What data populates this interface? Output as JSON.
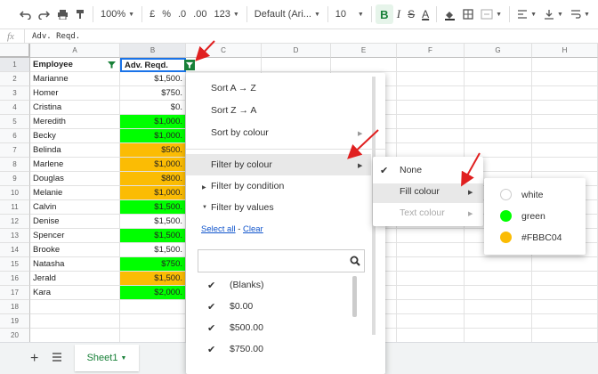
{
  "toolbar": {
    "zoom": "100%",
    "currency": "£",
    "percent": "%",
    "dec_decrease": ".0",
    "dec_increase": ".00",
    "number_format": "123",
    "font": "Default (Ari...",
    "font_size": "10",
    "bold": "B",
    "italic": "I",
    "strike": "S",
    "text_color": "A"
  },
  "formula_bar": {
    "fx": "fx",
    "value": "Adv. Reqd."
  },
  "columns": [
    "A",
    "B",
    "C",
    "D",
    "E",
    "F",
    "G",
    "H"
  ],
  "rows": [
    "1",
    "2",
    "3",
    "4",
    "5",
    "6",
    "7",
    "8",
    "9",
    "10",
    "11",
    "12",
    "13",
    "14",
    "15",
    "16",
    "17",
    "18",
    "19",
    "20"
  ],
  "header": {
    "employee": "Employee",
    "adv": "Adv. Reqd."
  },
  "data_rows": [
    {
      "name": "Marianne",
      "value": "$1,500.",
      "fill": "white"
    },
    {
      "name": "Homer",
      "value": "$750.",
      "fill": "white"
    },
    {
      "name": "Cristina",
      "value": "$0.",
      "fill": "white"
    },
    {
      "name": "Meredith",
      "value": "$1,000.",
      "fill": "#00ff00"
    },
    {
      "name": "Becky",
      "value": "$1,000.",
      "fill": "#00ff00"
    },
    {
      "name": "Belinda",
      "value": "$500.",
      "fill": "#FBBC04"
    },
    {
      "name": "Marlene",
      "value": "$1,000.",
      "fill": "#FBBC04"
    },
    {
      "name": "Douglas",
      "value": "$800.",
      "fill": "#FBBC04"
    },
    {
      "name": "Melanie",
      "value": "$1,000.",
      "fill": "#FBBC04"
    },
    {
      "name": "Calvin",
      "value": "$1,500.",
      "fill": "#00ff00"
    },
    {
      "name": "Denise",
      "value": "$1,500.",
      "fill": "white"
    },
    {
      "name": "Spencer",
      "value": "$1,500.",
      "fill": "#00ff00"
    },
    {
      "name": "Brooke",
      "value": "$1,500.",
      "fill": "white"
    },
    {
      "name": "Natasha",
      "value": "$750.",
      "fill": "#00ff00"
    },
    {
      "name": "Jerald",
      "value": "$1,500.",
      "fill": "#FBBC04"
    },
    {
      "name": "Kara",
      "value": "$2,000.",
      "fill": "#00ff00"
    }
  ],
  "filter_menu": {
    "sort_az": "Sort A → Z",
    "sort_za": "Sort Z → A",
    "sort_colour": "Sort by colour",
    "filter_colour": "Filter by colour",
    "filter_condition": "Filter by condition",
    "filter_values": "Filter by values",
    "select_all": "Select all",
    "sep": " - ",
    "clear": "Clear",
    "values": [
      "(Blanks)",
      "$0.00",
      "$500.00",
      "$750.00"
    ]
  },
  "colour_menu": {
    "none": "None",
    "fill": "Fill colour",
    "text": "Text colour"
  },
  "fill_menu": [
    {
      "label": "white",
      "color": "#ffffff"
    },
    {
      "label": "green",
      "color": "#00ff00"
    },
    {
      "label": "#FBBC04",
      "color": "#FBBC04"
    }
  ],
  "sheet": {
    "tab": "Sheet1"
  },
  "colors": {
    "accent": "#188038",
    "highlight_row": "#e8eaed",
    "annotation_arrow": "#e02020"
  }
}
